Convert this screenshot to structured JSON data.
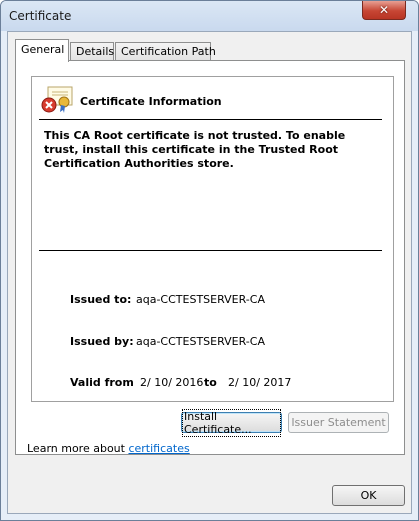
{
  "window": {
    "title": "Certificate",
    "close_glyph": "✕"
  },
  "tabs": [
    {
      "label": "General",
      "active": true
    },
    {
      "label": "Details",
      "active": false
    },
    {
      "label": "Certification Path",
      "active": false
    }
  ],
  "info": {
    "title": "Certificate Information",
    "icon": "certificate-error-icon",
    "warning": "This CA Root certificate is not trusted. To enable trust, install this certificate in the Trusted Root Certification Authorities store.",
    "issued_to_label": "Issued to:",
    "issued_to": "aqa-CCTESTSERVER-CA",
    "issued_by_label": "Issued by:",
    "issued_by": "aqa-CCTESTSERVER-CA",
    "valid_from_label": "Valid from",
    "valid_from": "2/ 10/ 2016",
    "valid_to_label": "to",
    "valid_to": "2/ 10/ 2017"
  },
  "buttons": {
    "install": "Install Certificate...",
    "issuer_statement": "Issuer Statement",
    "ok": "OK"
  },
  "learn_more": {
    "prefix": "Learn more about ",
    "link": "certificates"
  },
  "colors": {
    "link": "#0066cc",
    "close_button": "#c74634",
    "disabled_text": "#8d8d8d"
  }
}
